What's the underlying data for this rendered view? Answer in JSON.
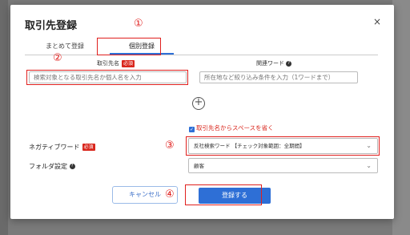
{
  "modal": {
    "title": "取引先登録",
    "close_glyph": "×",
    "tabs": [
      {
        "label": "まとめて登録",
        "active": false
      },
      {
        "label": "個別登録",
        "active": true
      }
    ],
    "fields": {
      "partner_name": {
        "label": "取引先名",
        "required_badge": "必須",
        "placeholder": "検索対象となる取引先名か個人名を入力"
      },
      "related_word": {
        "label": "関連ワード",
        "help_icon": "help-circle-icon",
        "placeholder": "所在地など絞り込み条件を入力（1ワードまで）"
      }
    },
    "add_glyph": "+",
    "remove_space_checkbox": {
      "label": "取引先名からスペースを省く",
      "checked": true
    },
    "negative_word": {
      "label": "ネガティブワード",
      "required_badge": "必須",
      "value": "反社検索ワード 【チェック対象範囲：全期間】"
    },
    "folder_setting": {
      "label": "フォルダ設定",
      "help_glyph": "?",
      "value": "顧客"
    },
    "buttons": {
      "cancel": "キャンセル",
      "submit": "登録する"
    }
  },
  "annotations": [
    "①",
    "②",
    "③",
    "④"
  ],
  "colors": {
    "accent": "#2e6fd6",
    "annotation": "#e0201e",
    "required": "#d9261c"
  }
}
